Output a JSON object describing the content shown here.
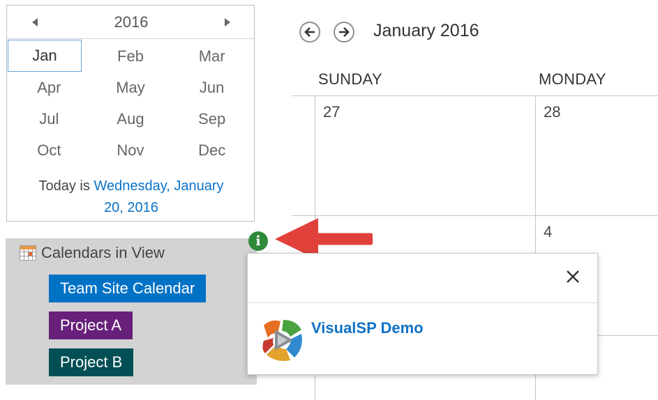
{
  "picker": {
    "year": "2016",
    "months": [
      "Jan",
      "Feb",
      "Mar",
      "Apr",
      "May",
      "Jun",
      "Jul",
      "Aug",
      "Sep",
      "Oct",
      "Nov",
      "Dec"
    ],
    "selected_month": "Jan",
    "today_prefix": "Today is",
    "today_date_line1": "Wednesday, January",
    "today_date_line2": "20, 2016"
  },
  "calendars_panel": {
    "title": "Calendars in View",
    "items": [
      {
        "label": "Team Site Calendar",
        "color": "#0072c6"
      },
      {
        "label": "Project A",
        "color": "#68217a"
      },
      {
        "label": "Project B",
        "color": "#034f56"
      }
    ]
  },
  "calendar": {
    "title": "January 2016",
    "days_of_week": [
      "SUNDAY",
      "MONDAY"
    ],
    "day_numbers": [
      "27",
      "28",
      "4"
    ]
  },
  "info_marker": {
    "glyph": "i",
    "icon": "info-icon",
    "color": "#2f8a3b"
  },
  "callout": {
    "item_name": "VisualSP Demo",
    "close_icon": "close-icon",
    "logo_icon": "visualsp-logo-icon"
  },
  "colors": {
    "accent_link": "#0a72c7",
    "arrow": "#e0413a",
    "panel_bg": "#d3d3d3"
  }
}
